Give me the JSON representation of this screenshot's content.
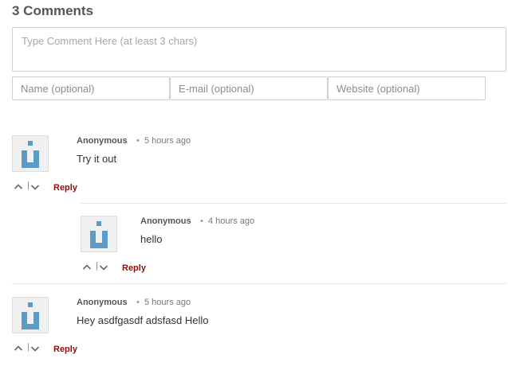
{
  "header": {
    "title": "3 Comments"
  },
  "form": {
    "comment_placeholder": "Type Comment Here (at least 3 chars)",
    "name_placeholder": "Name (optional)",
    "email_placeholder": "E-mail (optional)",
    "website_placeholder": "Website (optional)"
  },
  "comments": [
    {
      "author": "Anonymous",
      "time": "5 hours ago",
      "text": "Try it out",
      "reply_label": "Reply"
    },
    {
      "author": "Anonymous",
      "time": "4 hours ago",
      "text": "hello",
      "reply_label": "Reply"
    },
    {
      "author": "Anonymous",
      "time": "5 hours ago",
      "text": "Hey asdfgasdf adsfasd Hello",
      "reply_label": "Reply"
    }
  ],
  "colors": {
    "reply": "#8b0d0d",
    "avatar_icon": "#5b9bc8"
  },
  "icons": {
    "avatar": "default-user-avatar-icon",
    "upvote": "chevron-up-icon",
    "downvote": "chevron-down-icon"
  }
}
